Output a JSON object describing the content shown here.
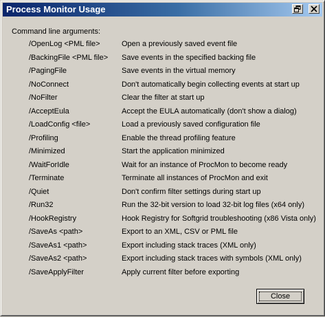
{
  "window": {
    "title": "Process Monitor Usage"
  },
  "heading": "Command line arguments:",
  "arguments": [
    {
      "arg": "/OpenLog <PML file>",
      "desc": "Open a previously saved event file"
    },
    {
      "arg": "/BackingFile <PML file>",
      "desc": "Save events in the specified backing file"
    },
    {
      "arg": "/PagingFile",
      "desc": "Save events in the virtual memory"
    },
    {
      "arg": "/NoConnect",
      "desc": "Don't automatically begin collecting events at start up"
    },
    {
      "arg": "/NoFilter",
      "desc": "Clear the filter at start up"
    },
    {
      "arg": "/AcceptEula",
      "desc": "Accept the EULA automatically (don't show a dialog)"
    },
    {
      "arg": "/LoadConfig <file>",
      "desc": "Load a previously saved configuration file"
    },
    {
      "arg": "/Profiling",
      "desc": "Enable the thread profiling feature"
    },
    {
      "arg": "/Minimized",
      "desc": "Start the application minimized"
    },
    {
      "arg": "/WaitForIdle",
      "desc": "Wait for an instance of ProcMon to become ready"
    },
    {
      "arg": "/Terminate",
      "desc": "Terminate all instances of ProcMon and exit"
    },
    {
      "arg": "/Quiet",
      "desc": "Don't confirm filter settings during start up"
    },
    {
      "arg": "/Run32",
      "desc": "Run the 32-bit version to load 32-bit log files (x64 only)"
    },
    {
      "arg": "/HookRegistry",
      "desc": "Hook Registry for Softgrid troubleshooting (x86 Vista only)"
    },
    {
      "arg": "/SaveAs <path>",
      "desc": "Export to an XML, CSV or PML file"
    },
    {
      "arg": "/SaveAs1 <path>",
      "desc": "Export including stack traces (XML only)"
    },
    {
      "arg": "/SaveAs2 <path>",
      "desc": "Export including stack traces with symbols (XML only)"
    },
    {
      "arg": "/SaveApplyFilter",
      "desc": "Apply current filter before exporting"
    }
  ],
  "buttons": {
    "close_label": "Close"
  },
  "icons": {
    "restore": "restore-icon",
    "close": "close-icon"
  },
  "colors": {
    "titlebar_start": "#0a246a",
    "titlebar_end": "#a6caf0",
    "face": "#d4d0c8"
  }
}
